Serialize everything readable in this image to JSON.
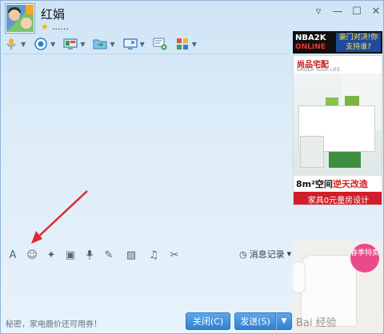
{
  "contact": {
    "name": "红娟",
    "status_text": "......"
  },
  "toolbar_top": [
    {
      "name": "voice-call-icon",
      "color": "#e7a52a"
    },
    {
      "name": "video-call-icon",
      "color": "#2f7fd0"
    },
    {
      "name": "remote-desktop-icon",
      "color": "#3a9a4a"
    },
    {
      "name": "send-file-icon",
      "color": "#2f9bd6"
    },
    {
      "name": "screen-share-icon",
      "color": "#2f7fd0"
    },
    {
      "name": "group-chat-icon",
      "color": "#3aa655"
    },
    {
      "name": "apps-icon",
      "color": "#e05b3b"
    }
  ],
  "toolbar_bottom": [
    {
      "name": "font-icon",
      "glyph": "A"
    },
    {
      "name": "emoji-icon",
      "glyph": "☺"
    },
    {
      "name": "shake-icon",
      "glyph": "✦"
    },
    {
      "name": "video-clip-icon",
      "glyph": "▣"
    },
    {
      "name": "voice-message-icon",
      "glyph": "🎙"
    },
    {
      "name": "edit-icon",
      "glyph": "✎"
    },
    {
      "name": "image-icon",
      "glyph": "▨"
    },
    {
      "name": "music-icon",
      "glyph": "♫"
    },
    {
      "name": "screenshot-icon",
      "glyph": "✂"
    }
  ],
  "history": {
    "label": "消息记录"
  },
  "hint": "秘密，家电鹿价还可用券！",
  "buttons": {
    "close": "关闭(C)",
    "send": "发送(S)"
  },
  "ads": {
    "ad1_logo": "NBA2K",
    "ad1_logo2": "ONLINE",
    "ad1_slogan": "豪门对决!你支持谁?",
    "ad2_brand": "尚品宅配",
    "ad2_brand_sub": "ORDER YOUR LIFE",
    "ad2_tag1_prefix": "8m²空间",
    "ad2_tag1_highlight": "逆天改造",
    "ad2_tag2": "家具0元量房设计",
    "ad3_sale": "春季特卖",
    "ad3_watermark": "Bai 经验"
  },
  "annotation": {
    "color": "#e0282e"
  }
}
